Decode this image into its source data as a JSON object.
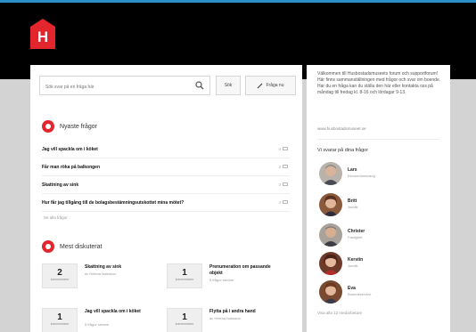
{
  "colors": {
    "accent": "#e3262d",
    "header": "#000000",
    "topline": "#2a8fc7",
    "canvas": "#d3d3d3"
  },
  "logo": {
    "letter": "H"
  },
  "search": {
    "placeholder": "Sök svar på en fråga här",
    "search_label": "Sök",
    "ask_label": "Fråga nu"
  },
  "new_questions": {
    "title": "Nyaste frågor",
    "items": [
      {
        "text": "Jag vill spackla om i köket",
        "count": "4"
      },
      {
        "text": "Får man röka på balkongen",
        "count": "3"
      },
      {
        "text": "Skattning av sink",
        "count": "3"
      },
      {
        "text": "Hur får jag tillgång till de bolagsbestämningsutskottet mina mötet?",
        "count": "4"
      }
    ],
    "all_link": "Se alla frågor"
  },
  "most_discussed": {
    "title": "Mest diskuterat",
    "count_label": "kommentarer",
    "items": [
      {
        "count": "2",
        "title": "Skattning av sink",
        "sub": "av Helena Isaksson"
      },
      {
        "count": "1",
        "title": "Prenumeration om passande objekt",
        "sub": "5 frågor senare"
      },
      {
        "count": "1",
        "title": "Jag vill spackla om i köket",
        "sub": "5 frågor senare"
      },
      {
        "count": "1",
        "title": "Flytta på i andra hand",
        "sub": "av Helena Isaksson"
      }
    ]
  },
  "sidebar": {
    "intro": "Välkommen till Husbostadsmuseets forum och supportforum! Här finns sammanställningen med frågor och svar om boende. Har du en fråga kan du ställa den här eller kontakta oss på måndag till fredag kl. 8-16 och lördagar 9-13.",
    "link": "www.husbostadsmuseet.se",
    "experts_title": "Vi svarar på dina frågor",
    "experts": [
      {
        "name": "Lars",
        "role": "Ekonomiansvarig"
      },
      {
        "name": "Britt",
        "role": "Juridik"
      },
      {
        "name": "Christer",
        "role": "Fastighet"
      },
      {
        "name": "Kerstin",
        "role": "Juridik"
      },
      {
        "name": "Eva",
        "role": "Boendeservice"
      }
    ],
    "all_link": "Visa alla 12 medarbetare"
  }
}
